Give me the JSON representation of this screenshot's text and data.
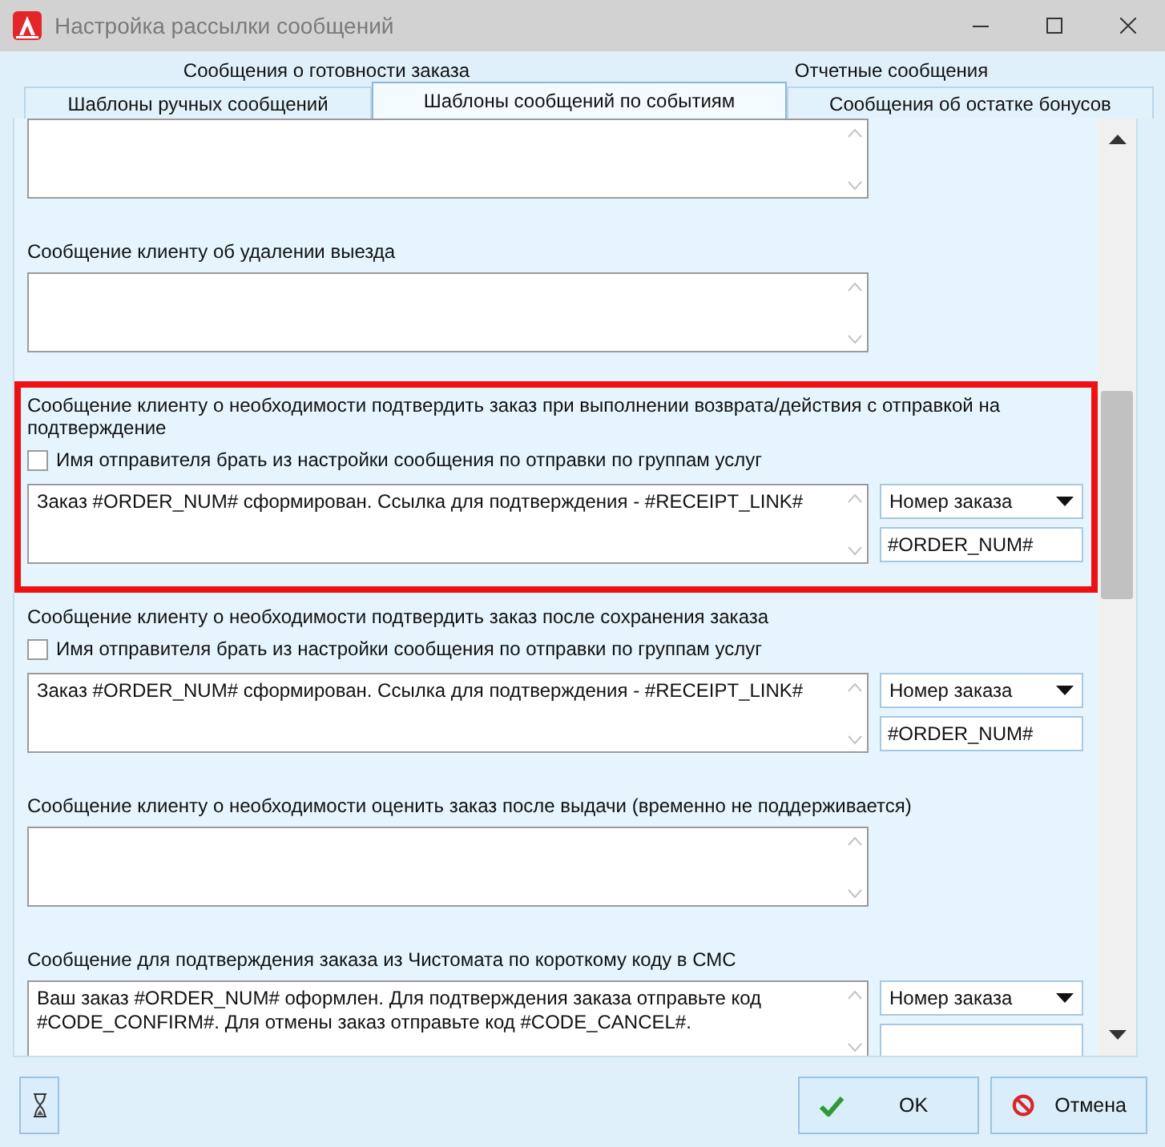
{
  "window": {
    "title": "Настройка рассылки сообщений"
  },
  "tabs": [
    [
      {
        "label": "Сообщения о готовности заказа",
        "selected": false
      },
      {
        "label": "Отчетные сообщения",
        "selected": false
      }
    ],
    [
      {
        "label": "Шаблоны ручных сообщений",
        "selected": false
      },
      {
        "label": "Шаблоны сообщений по событиям",
        "selected": true
      },
      {
        "label": "Сообщения об остатке бонусов",
        "selected": false
      }
    ]
  ],
  "sections": [
    {
      "highlighted": false
    },
    {
      "label": "Сообщение клиенту об удалении выезда",
      "highlighted": false
    },
    {
      "label": "Сообщение клиенту о необходимости подтвердить заказ при выполнении возврата/действия с отправкой на подтверждение",
      "highlighted": true,
      "checkbox": {
        "label": "Имя отправителя брать из настройки сообщения по отправки по группам услуг",
        "checked": false
      },
      "text": "Заказ #ORDER_NUM# сформирован. Ссылка для подтверждения - #RECEIPT_LINK#",
      "variable": {
        "dropdown": "Номер заказа",
        "value": "#ORDER_NUM#"
      }
    },
    {
      "label": "Сообщение клиенту о необходимости подтвердить заказ после сохранения заказа",
      "highlighted": false,
      "checkbox": {
        "label": "Имя отправителя брать из настройки сообщения по отправки по группам услуг",
        "checked": false
      },
      "text": "Заказ #ORDER_NUM# сформирован. Ссылка для подтверждения - #RECEIPT_LINK#",
      "variable": {
        "dropdown": "Номер заказа",
        "value": "#ORDER_NUM#"
      }
    },
    {
      "label": "Сообщение клиенту о необходимости оценить заказ после выдачи (временно не поддерживается)",
      "highlighted": false
    },
    {
      "label": "Сообщение для подтверждения заказа из Чистомата по короткому коду в СМС",
      "highlighted": false,
      "text": "Ваш заказ #ORDER_NUM# оформлен. Для подтверждения заказа отправьте код #CODE_CONFIRM#. Для отмены заказ отправьте код #CODE_CANCEL#.",
      "variable": {
        "dropdown": "Номер заказа"
      }
    }
  ],
  "buttons": [
    {
      "kind": "ok",
      "label": "OK"
    },
    {
      "kind": "cancel",
      "label": "Отмена"
    }
  ]
}
